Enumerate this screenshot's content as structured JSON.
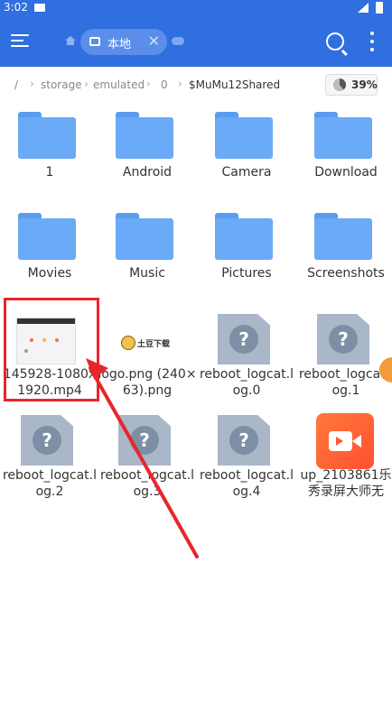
{
  "status_bar": {
    "time": "3:02"
  },
  "app_bar": {
    "tab": {
      "label": "本地",
      "close": "✕"
    }
  },
  "breadcrumb": {
    "root": "/",
    "items": [
      "storage",
      "emulated",
      "0",
      "$MuMu12Shared"
    ],
    "storage_percent": "39%"
  },
  "files": [
    {
      "name": "1",
      "type": "folder"
    },
    {
      "name": "Android",
      "type": "folder"
    },
    {
      "name": "Camera",
      "type": "folder"
    },
    {
      "name": "Download",
      "type": "folder"
    },
    {
      "name": "Movies",
      "type": "folder"
    },
    {
      "name": "Music",
      "type": "folder"
    },
    {
      "name": "Pictures",
      "type": "folder"
    },
    {
      "name": "Screenshots",
      "type": "folder"
    },
    {
      "name": "145928-1080x1920.mp4",
      "type": "video"
    },
    {
      "name": "logo.png (240×63).png",
      "type": "image",
      "logo_text": "土豆下载"
    },
    {
      "name": "reboot_logcat.log.0",
      "type": "unknown"
    },
    {
      "name": "reboot_logcat.log.1",
      "type": "unknown"
    },
    {
      "name": "reboot_logcat.log.2",
      "type": "unknown"
    },
    {
      "name": "reboot_logcat.log.3",
      "type": "unknown"
    },
    {
      "name": "reboot_logcat.log.4",
      "type": "unknown"
    },
    {
      "name": "up_2103861乐秀录屏大师无",
      "type": "app"
    }
  ],
  "colors": {
    "accent": "#2f6fe0",
    "folder": "#6aaaf6",
    "annotation": "#e8262a"
  }
}
